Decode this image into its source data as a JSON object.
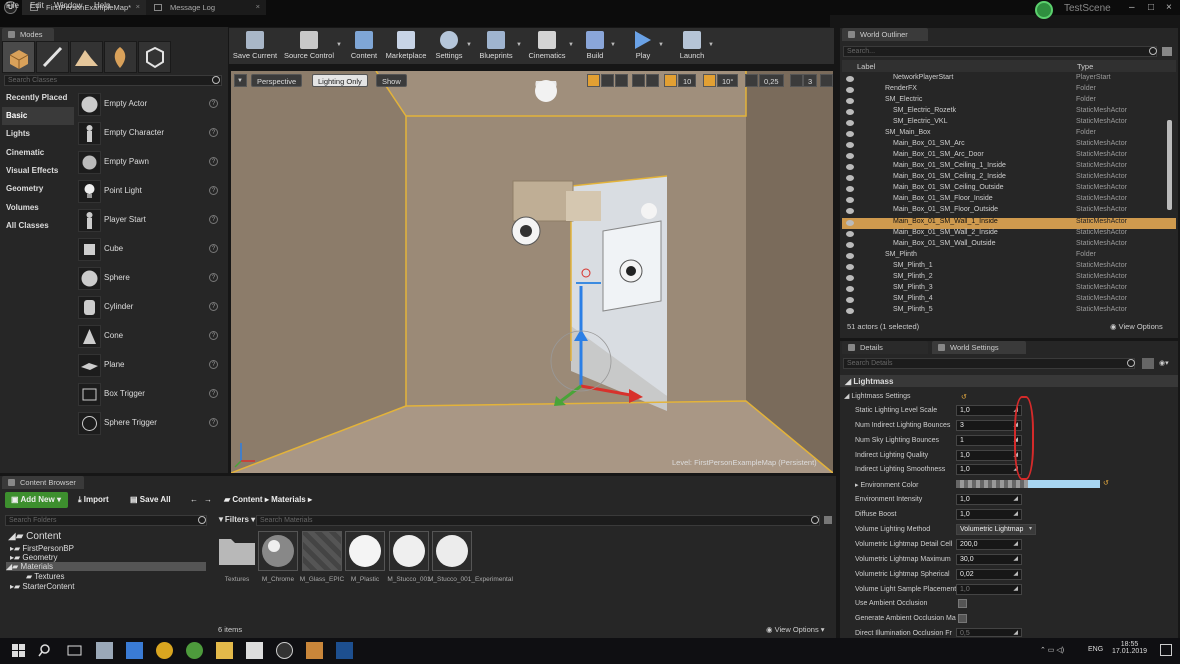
{
  "titlebar": {
    "tabs": [
      {
        "label": "FirstPersonExampleMap*"
      },
      {
        "label": "Message Log"
      }
    ],
    "scene_name": "TestScene"
  },
  "menu": [
    "File",
    "Edit",
    "Window",
    "Help"
  ],
  "modes": {
    "tab_label": "Modes",
    "search_placeholder": "Search Classes",
    "categories": [
      "Recently Placed",
      "Basic",
      "Lights",
      "Cinematic",
      "Visual Effects",
      "Geometry",
      "Volumes",
      "All Classes"
    ],
    "selected_category": "Basic",
    "actors": [
      "Empty Actor",
      "Empty Character",
      "Empty Pawn",
      "Point Light",
      "Player Start",
      "Cube",
      "Sphere",
      "Cylinder",
      "Cone",
      "Plane",
      "Box Trigger",
      "Sphere Trigger"
    ]
  },
  "toolbar": {
    "buttons": [
      "Save Current",
      "Source Control",
      "Content",
      "Marketplace",
      "Settings",
      "Blueprints",
      "Cinematics",
      "Build",
      "Play",
      "Launch"
    ]
  },
  "viewport": {
    "perspective_label": "Perspective",
    "lighting_label": "Lighting Only",
    "show_label": "Show",
    "grid_snap": "10",
    "rot_snap": "10°",
    "scale_snap": "0,25",
    "camera_speed": "3",
    "level_label": "Level:",
    "level_name": "FirstPersonExampleMap (Persistent)"
  },
  "outliner": {
    "tab_label": "World Outliner",
    "search_placeholder": "Search...",
    "col_label": "Label",
    "col_type": "Type",
    "rows": [
      {
        "name": "NetworkPlayerStart",
        "type": "PlayerStart"
      },
      {
        "name": "RenderFX",
        "type": "Folder"
      },
      {
        "name": "SM_Electric",
        "type": "Folder"
      },
      {
        "name": "SM_Electric_Rozetk",
        "type": "StaticMeshActor"
      },
      {
        "name": "SM_Electric_VKL",
        "type": "StaticMeshActor"
      },
      {
        "name": "SM_Main_Box",
        "type": "Folder"
      },
      {
        "name": "Main_Box_01_SM_Arc",
        "type": "StaticMeshActor"
      },
      {
        "name": "Main_Box_01_SM_Arc_Door",
        "type": "StaticMeshActor"
      },
      {
        "name": "Main_Box_01_SM_Ceiling_1_Inside",
        "type": "StaticMeshActor"
      },
      {
        "name": "Main_Box_01_SM_Ceiling_2_Inside",
        "type": "StaticMeshActor"
      },
      {
        "name": "Main_Box_01_SM_Ceiling_Outside",
        "type": "StaticMeshActor"
      },
      {
        "name": "Main_Box_01_SM_Floor_Inside",
        "type": "StaticMeshActor"
      },
      {
        "name": "Main_Box_01_SM_Floor_Outside",
        "type": "StaticMeshActor"
      },
      {
        "name": "Main_Box_01_SM_Wall_1_Inside",
        "type": "StaticMeshActor"
      },
      {
        "name": "Main_Box_01_SM_Wall_2_Inside",
        "type": "StaticMeshActor"
      },
      {
        "name": "Main_Box_01_SM_Wall_Outside",
        "type": "StaticMeshActor"
      },
      {
        "name": "SM_Plinth",
        "type": "Folder"
      },
      {
        "name": "SM_Plinth_1",
        "type": "StaticMeshActor"
      },
      {
        "name": "SM_Plinth_2",
        "type": "StaticMeshActor"
      },
      {
        "name": "SM_Plinth_3",
        "type": "StaticMeshActor"
      },
      {
        "name": "SM_Plinth_4",
        "type": "StaticMeshActor"
      },
      {
        "name": "SM_Plinth_5",
        "type": "StaticMeshActor"
      }
    ],
    "selected_row": "Main_Box_01_SM_Wall_1_Inside",
    "status": "51 actors (1 selected)",
    "view_options": "View Options"
  },
  "details": {
    "tab_details": "Details",
    "tab_world_settings": "World Settings",
    "search_placeholder": "Search Details",
    "section": "Lightmass",
    "subsection": "Lightmass Settings",
    "props": [
      {
        "label": "Static Lighting Level Scale",
        "value": "1,0"
      },
      {
        "label": "Num Indirect Lighting Bounces",
        "value": "3"
      },
      {
        "label": "Num Sky Lighting Bounces",
        "value": "1"
      },
      {
        "label": "Indirect Lighting Quality",
        "value": "1,0"
      },
      {
        "label": "Indirect Lighting Smoothness",
        "value": "1,0"
      },
      {
        "label": "Environment Color",
        "value": ""
      },
      {
        "label": "Environment Intensity",
        "value": "1,0"
      },
      {
        "label": "Diffuse Boost",
        "value": "1,0"
      },
      {
        "label": "Volume Lighting Method",
        "value": "Volumetric Lightmap"
      },
      {
        "label": "Volumetric Lightmap Detail Cell",
        "value": "200,0"
      },
      {
        "label": "Volumetric Lightmap Maximum",
        "value": "30,0"
      },
      {
        "label": "Volumetric Lightmap Spherical",
        "value": "0,02"
      },
      {
        "label": "Volume Light Sample Placement",
        "value": "1,0"
      },
      {
        "label": "Use Ambient Occlusion",
        "value": ""
      },
      {
        "label": "Generate Ambient Occlusion Ma",
        "value": ""
      },
      {
        "label": "Direct Illumination Occlusion Fr",
        "value": "0,5"
      }
    ]
  },
  "content_browser": {
    "tab_label": "Content Browser",
    "add_new": "Add New",
    "import": "Import",
    "save_all": "Save All",
    "breadcrumb": [
      "Content",
      "Materials"
    ],
    "search_folders": "Search Folders",
    "filters": "Filters",
    "search_materials": "Search Materials",
    "tree": [
      {
        "label": "Content",
        "depth": 0
      },
      {
        "label": "FirstPersonBP",
        "depth": 1
      },
      {
        "label": "Geometry",
        "depth": 1
      },
      {
        "label": "Materials",
        "depth": 1
      },
      {
        "label": "Textures",
        "depth": 2
      },
      {
        "label": "StarterContent",
        "depth": 1
      }
    ],
    "assets": [
      "Textures",
      "M_Chrome",
      "M_Glass_EPIC",
      "M_Plastic",
      "M_Stucco_001",
      "M_Stucco_001_Experimental"
    ],
    "item_count": "6 items",
    "view_options": "View Options"
  },
  "taskbar": {
    "lang": "ENG",
    "time": "18:55",
    "date": "17.01.2019"
  }
}
